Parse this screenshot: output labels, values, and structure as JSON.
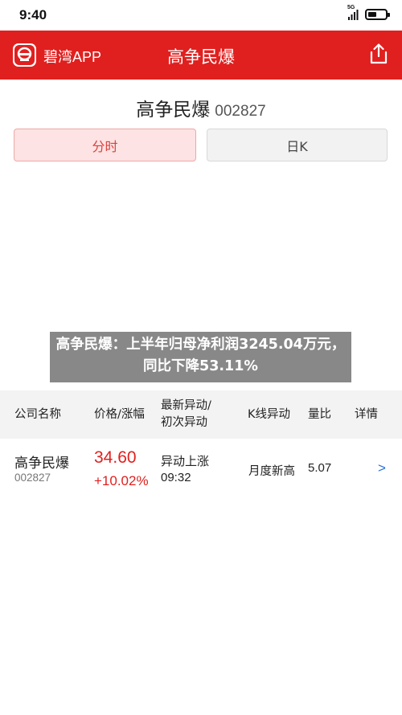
{
  "status_bar": {
    "time": "9:40",
    "network_label": "5G",
    "battery_level": 0.5,
    "icons": [
      "signal-icon",
      "battery-icon"
    ]
  },
  "header": {
    "app_name": "碧湾APP",
    "title": "高争民爆",
    "logo_icon": "app-logo-icon",
    "share_icon": "share-icon",
    "background_color": "#e0201f"
  },
  "stock": {
    "name": "高争民爆",
    "code": "002827"
  },
  "tabs": [
    {
      "label": "分时",
      "active": true
    },
    {
      "label": "日K",
      "active": false
    }
  ],
  "banner": {
    "text": "高争民爆：上半年归母净利润3245.04万元，同比下降53.11%"
  },
  "table": {
    "headers": {
      "name": "公司名称",
      "price": "价格/涨幅",
      "move_line1": "最新异动/",
      "move_line2": "初次异动",
      "k": "K线异动",
      "volume_ratio": "量比",
      "detail": "详情"
    },
    "rows": [
      {
        "name": "高争民爆",
        "code": "002827",
        "price": "34.60",
        "change": "+10.02%",
        "move": "异动上涨",
        "time": "09:32",
        "k": "月度新高",
        "volume_ratio": "5.07",
        "detail_arrow": ">"
      }
    ]
  },
  "colors": {
    "accent_red": "#e0201f",
    "link_blue": "#2a6fd6"
  }
}
